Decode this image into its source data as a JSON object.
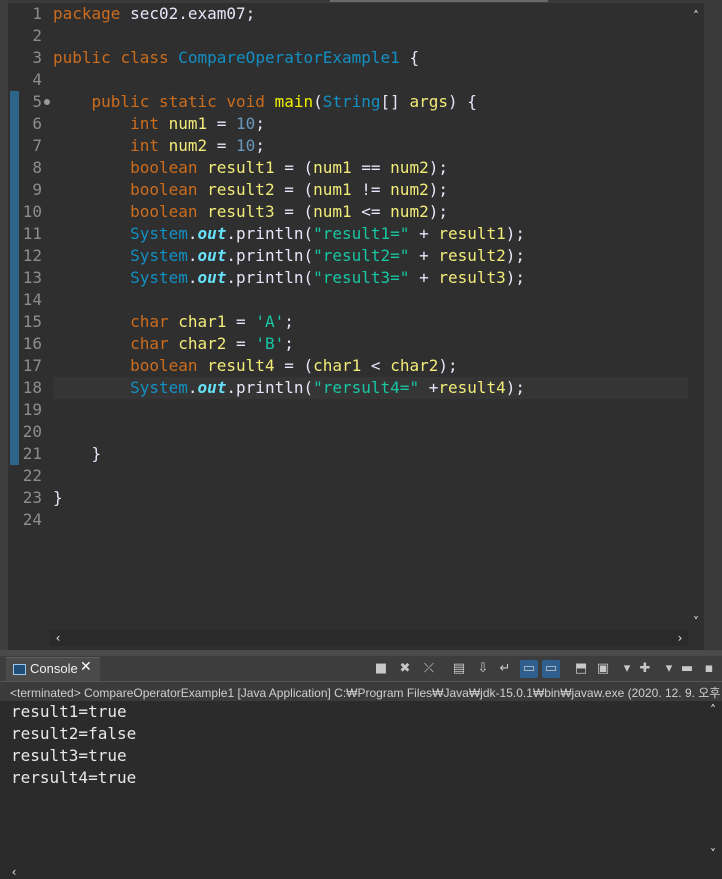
{
  "editor": {
    "line_numbers": [
      "1",
      "2",
      "3",
      "4",
      "5",
      "6",
      "7",
      "8",
      "9",
      "10",
      "11",
      "12",
      "13",
      "14",
      "15",
      "16",
      "17",
      "18",
      "19",
      "20",
      "21",
      "22",
      "23",
      "24"
    ],
    "lines": [
      {
        "indent": "",
        "tokens": [
          {
            "t": "package",
            "c": "kw"
          },
          {
            "t": " sec02.exam07;",
            "c": "op"
          }
        ]
      },
      {
        "indent": "",
        "tokens": []
      },
      {
        "indent": "",
        "tokens": [
          {
            "t": "public",
            "c": "kw"
          },
          {
            "t": " ",
            "c": "op"
          },
          {
            "t": "class",
            "c": "kw"
          },
          {
            "t": " ",
            "c": "op"
          },
          {
            "t": "CompareOperatorExample1",
            "c": "ty"
          },
          {
            "t": " {",
            "c": "op"
          }
        ]
      },
      {
        "indent": "",
        "tokens": []
      },
      {
        "indent": "    ",
        "tokens": [
          {
            "t": "public",
            "c": "kw"
          },
          {
            "t": " ",
            "c": "op"
          },
          {
            "t": "static",
            "c": "kw"
          },
          {
            "t": " ",
            "c": "op"
          },
          {
            "t": "void",
            "c": "kw"
          },
          {
            "t": " ",
            "c": "op"
          },
          {
            "t": "main",
            "c": "id"
          },
          {
            "t": "(",
            "c": "op"
          },
          {
            "t": "String",
            "c": "ty"
          },
          {
            "t": "[] ",
            "c": "op"
          },
          {
            "t": "args",
            "c": "va"
          },
          {
            "t": ") {",
            "c": "op"
          }
        ]
      },
      {
        "indent": "        ",
        "tokens": [
          {
            "t": "int",
            "c": "kw"
          },
          {
            "t": " ",
            "c": "op"
          },
          {
            "t": "num1",
            "c": "va"
          },
          {
            "t": " = ",
            "c": "op"
          },
          {
            "t": "10",
            "c": "nm"
          },
          {
            "t": ";",
            "c": "op"
          }
        ]
      },
      {
        "indent": "        ",
        "tokens": [
          {
            "t": "int",
            "c": "kw"
          },
          {
            "t": " ",
            "c": "op"
          },
          {
            "t": "num2",
            "c": "va"
          },
          {
            "t": " = ",
            "c": "op"
          },
          {
            "t": "10",
            "c": "nm"
          },
          {
            "t": ";",
            "c": "op"
          }
        ]
      },
      {
        "indent": "        ",
        "tokens": [
          {
            "t": "boolean",
            "c": "kw"
          },
          {
            "t": " ",
            "c": "op"
          },
          {
            "t": "result1",
            "c": "va"
          },
          {
            "t": " = (",
            "c": "op"
          },
          {
            "t": "num1",
            "c": "va"
          },
          {
            "t": " == ",
            "c": "op"
          },
          {
            "t": "num2",
            "c": "va"
          },
          {
            "t": ");",
            "c": "op"
          }
        ]
      },
      {
        "indent": "        ",
        "tokens": [
          {
            "t": "boolean",
            "c": "kw"
          },
          {
            "t": " ",
            "c": "op"
          },
          {
            "t": "result2",
            "c": "va"
          },
          {
            "t": " = (",
            "c": "op"
          },
          {
            "t": "num1",
            "c": "va"
          },
          {
            "t": " != ",
            "c": "op"
          },
          {
            "t": "num2",
            "c": "va"
          },
          {
            "t": ");",
            "c": "op"
          }
        ]
      },
      {
        "indent": "        ",
        "tokens": [
          {
            "t": "boolean",
            "c": "kw"
          },
          {
            "t": " ",
            "c": "op"
          },
          {
            "t": "result3",
            "c": "va"
          },
          {
            "t": " = (",
            "c": "op"
          },
          {
            "t": "num1",
            "c": "va"
          },
          {
            "t": " <= ",
            "c": "op"
          },
          {
            "t": "num2",
            "c": "va"
          },
          {
            "t": ");",
            "c": "op"
          }
        ]
      },
      {
        "indent": "        ",
        "tokens": [
          {
            "t": "System",
            "c": "ty"
          },
          {
            "t": ".",
            "c": "op"
          },
          {
            "t": "out",
            "c": "fi"
          },
          {
            "t": ".println(",
            "c": "op"
          },
          {
            "t": "\"result1=\"",
            "c": "st"
          },
          {
            "t": " + ",
            "c": "op"
          },
          {
            "t": "result1",
            "c": "va"
          },
          {
            "t": ");",
            "c": "op"
          }
        ]
      },
      {
        "indent": "        ",
        "tokens": [
          {
            "t": "System",
            "c": "ty"
          },
          {
            "t": ".",
            "c": "op"
          },
          {
            "t": "out",
            "c": "fi"
          },
          {
            "t": ".println(",
            "c": "op"
          },
          {
            "t": "\"result2=\"",
            "c": "st"
          },
          {
            "t": " + ",
            "c": "op"
          },
          {
            "t": "result2",
            "c": "va"
          },
          {
            "t": ");",
            "c": "op"
          }
        ]
      },
      {
        "indent": "        ",
        "tokens": [
          {
            "t": "System",
            "c": "ty"
          },
          {
            "t": ".",
            "c": "op"
          },
          {
            "t": "out",
            "c": "fi"
          },
          {
            "t": ".println(",
            "c": "op"
          },
          {
            "t": "\"result3=\"",
            "c": "st"
          },
          {
            "t": " + ",
            "c": "op"
          },
          {
            "t": "result3",
            "c": "va"
          },
          {
            "t": ");",
            "c": "op"
          }
        ]
      },
      {
        "indent": "",
        "tokens": []
      },
      {
        "indent": "        ",
        "tokens": [
          {
            "t": "char",
            "c": "kw"
          },
          {
            "t": " ",
            "c": "op"
          },
          {
            "t": "char1",
            "c": "va"
          },
          {
            "t": " = ",
            "c": "op"
          },
          {
            "t": "'A'",
            "c": "st"
          },
          {
            "t": ";",
            "c": "op"
          }
        ]
      },
      {
        "indent": "        ",
        "tokens": [
          {
            "t": "char",
            "c": "kw"
          },
          {
            "t": " ",
            "c": "op"
          },
          {
            "t": "char2",
            "c": "va"
          },
          {
            "t": " = ",
            "c": "op"
          },
          {
            "t": "'B'",
            "c": "st"
          },
          {
            "t": ";",
            "c": "op"
          }
        ]
      },
      {
        "indent": "        ",
        "tokens": [
          {
            "t": "boolean",
            "c": "kw"
          },
          {
            "t": " ",
            "c": "op"
          },
          {
            "t": "result4",
            "c": "va"
          },
          {
            "t": " = (",
            "c": "op"
          },
          {
            "t": "char1",
            "c": "va"
          },
          {
            "t": " < ",
            "c": "op"
          },
          {
            "t": "char2",
            "c": "va"
          },
          {
            "t": ");",
            "c": "op"
          }
        ]
      },
      {
        "indent": "        ",
        "tokens": [
          {
            "t": "System",
            "c": "ty"
          },
          {
            "t": ".",
            "c": "op"
          },
          {
            "t": "out",
            "c": "fi"
          },
          {
            "t": ".println(",
            "c": "op"
          },
          {
            "t": "\"rersult4=\"",
            "c": "st"
          },
          {
            "t": " +",
            "c": "op"
          },
          {
            "t": "result4",
            "c": "va"
          },
          {
            "t": ");",
            "c": "op"
          }
        ]
      },
      {
        "indent": "",
        "tokens": []
      },
      {
        "indent": "",
        "tokens": []
      },
      {
        "indent": "    ",
        "tokens": [
          {
            "t": "}",
            "c": "op"
          }
        ]
      },
      {
        "indent": "",
        "tokens": []
      },
      {
        "indent": "",
        "tokens": [
          {
            "t": "}",
            "c": "op"
          }
        ]
      },
      {
        "indent": "",
        "tokens": []
      }
    ],
    "current_line": 18,
    "fold_line": 5
  },
  "console": {
    "tab_label": "Console",
    "close_glyph": "✕",
    "status": "<terminated> CompareOperatorExample1 [Java Application] C:₩Program Files₩Java₩jdk-15.0.1₩bin₩javaw.exe  (2020. 12. 9. 오후",
    "output": [
      "result1=true",
      "result2=false",
      "result3=true",
      "rersult4=true"
    ],
    "toolbar": [
      {
        "name": "terminate-icon",
        "glyph": "■"
      },
      {
        "name": "remove-launch-icon",
        "glyph": "✖"
      },
      {
        "name": "remove-all-terminated-icon",
        "glyph": "⤫"
      },
      {
        "name": "clear-console-icon",
        "glyph": "▤"
      },
      {
        "name": "scroll-lock-icon",
        "glyph": "⇩"
      },
      {
        "name": "word-wrap-icon",
        "glyph": "↵"
      },
      {
        "name": "show-on-stdout-icon",
        "glyph": "▭",
        "selected": true
      },
      {
        "name": "show-on-stderr-icon",
        "glyph": "▭",
        "selected": true
      },
      {
        "name": "pin-console-icon",
        "glyph": "⬒"
      },
      {
        "name": "display-console-icon",
        "glyph": "▣"
      },
      {
        "name": "display-dropdown-icon",
        "glyph": "▾"
      },
      {
        "name": "open-console-icon",
        "glyph": "✚"
      },
      {
        "name": "open-dropdown-icon",
        "glyph": "▾"
      },
      {
        "name": "minimize-icon",
        "glyph": "▬"
      },
      {
        "name": "maximize-icon",
        "glyph": "▪"
      }
    ]
  }
}
